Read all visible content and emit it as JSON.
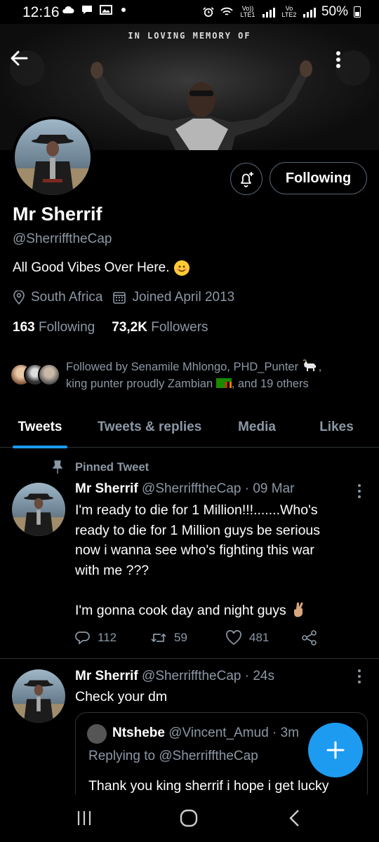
{
  "status_bar": {
    "time": "12:16",
    "battery": "50%",
    "lte1": "Vo)) LTE1",
    "lte2": "Vo LTE2"
  },
  "banner": {
    "caption": "IN LOVING MEMORY OF"
  },
  "profile": {
    "name": "Mr Sherrif",
    "handle": "@SherrifftheCap",
    "bio": "All Good Vibes Over Here.",
    "location": "South Africa",
    "joined": "Joined April 2013",
    "following_count": "163",
    "following_label": "Following",
    "followers_count": "73,2K",
    "followers_label": "Followers",
    "followed_by_line1": "Followed by Senamile Mhlongo, PHD_Punter",
    "followed_by_line2a": "king punter proudly Zambian",
    "followed_by_line2b": ", and 19 others",
    "following_button": "Following"
  },
  "tabs": [
    "Tweets",
    "Tweets & replies",
    "Media",
    "Likes"
  ],
  "pinned_tweet": {
    "pinned_label": "Pinned Tweet",
    "name": "Mr Sherrif",
    "handle_time": "@SherrifftheCap · 09 Mar",
    "text_line1": "I'm ready to die for 1 Million!!!.......Who's",
    "text_line2": "ready to die for 1 Million guys be serious",
    "text_line3": "now i wanna see who's fighting this war",
    "text_line4": "with me ???",
    "text_line5": "I'm gonna cook day and night guys",
    "replies": "112",
    "retweets": "59",
    "likes": "481"
  },
  "second_tweet": {
    "name": "Mr Sherrif",
    "handle_time": "@SherrifftheCap · 24s",
    "text": "Check your dm",
    "quote": {
      "name": "Ntshebe",
      "handle_time": "@Vincent_Amud · 3m",
      "replying_to": "Replying to @SherrifftheCap",
      "text": "Thank you king sherrif i hope i get lucky"
    }
  },
  "colors": {
    "accent": "#1d9bf0",
    "background": "#000000",
    "secondary_text": "#8b98a5",
    "border": "#2f3336"
  }
}
